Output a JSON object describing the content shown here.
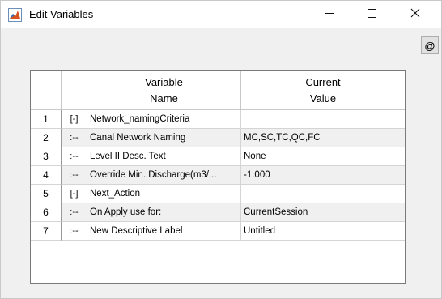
{
  "window": {
    "title": "Edit Variables",
    "icon": "matlab-icon",
    "controls": [
      "minimize-icon",
      "maximize-icon",
      "close-icon"
    ]
  },
  "toolbar": {
    "at_label": "@"
  },
  "table": {
    "headers": {
      "name_line1": "Variable",
      "name_line2": "Name",
      "value_line1": "Current",
      "value_line2": "Value"
    },
    "rows": [
      {
        "num": "1",
        "tree": "[-]",
        "name": "Network_namingCriteria",
        "value": ""
      },
      {
        "num": "2",
        "tree": ":--",
        "name": "Canal Network Naming",
        "value": "MC,SC,TC,QC,FC"
      },
      {
        "num": "3",
        "tree": ":--",
        "name": "Level II Desc. Text",
        "value": "None"
      },
      {
        "num": "4",
        "tree": ":--",
        "name": "Override Min. Discharge(m3/...",
        "value": "-1.000"
      },
      {
        "num": "5",
        "tree": "[-]",
        "name": "Next_Action",
        "value": ""
      },
      {
        "num": "6",
        "tree": ":--",
        "name": "On Apply use for:",
        "value": "CurrentSession"
      },
      {
        "num": "7",
        "tree": ":--",
        "name": "New Descriptive Label",
        "value": "Untitled"
      }
    ]
  }
}
